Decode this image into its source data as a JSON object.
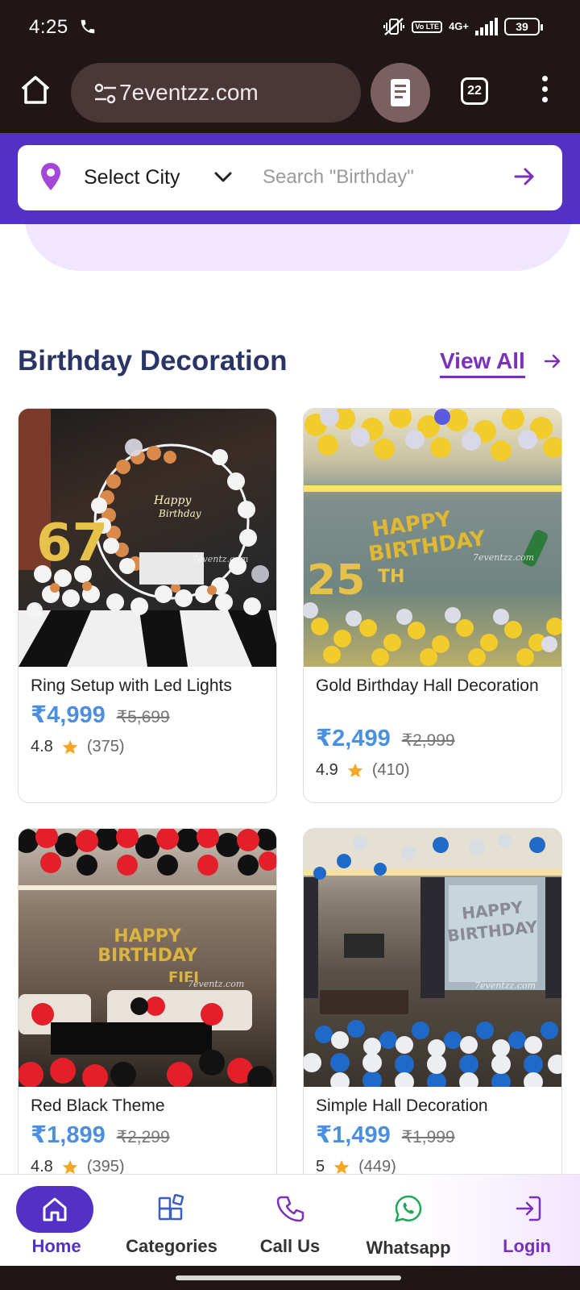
{
  "status_bar": {
    "time": "4:25",
    "volte_label": "Vo LTE",
    "network": "4G+",
    "battery": "39"
  },
  "browser": {
    "url": "7eventzz.com",
    "tab_count": "22"
  },
  "search": {
    "city_label": "Select City",
    "placeholder": "Search \"Birthday\""
  },
  "section": {
    "title": "Birthday Decoration",
    "view_all": "View All"
  },
  "products": [
    {
      "title": "Ring Setup with Led Lights",
      "price": "₹4,999",
      "mrp": "₹5,699",
      "rating": "4.8",
      "reviews": "(375)",
      "watermark": "7eventz.com"
    },
    {
      "title": "Gold Birthday Hall Decoration",
      "price": "₹2,499",
      "mrp": "₹2,999",
      "rating": "4.9",
      "reviews": "(410)",
      "watermark": "7eventzz.com"
    },
    {
      "title": "Red Black Theme",
      "price": "₹1,899",
      "mrp": "₹2,299",
      "rating": "4.8",
      "reviews": "(395)",
      "watermark": "7eventz.com"
    },
    {
      "title": "Simple Hall Decoration",
      "price": "₹1,499",
      "mrp": "₹1,999",
      "rating": "5",
      "reviews": "(449)",
      "watermark": "7eventzz.com"
    }
  ],
  "bottom_nav": {
    "items": [
      {
        "label": "Home",
        "icon": "home-icon"
      },
      {
        "label": "Categories",
        "icon": "categories-icon"
      },
      {
        "label": "Call Us",
        "icon": "phone-icon"
      },
      {
        "label": "Whatsapp",
        "icon": "whatsapp-icon"
      },
      {
        "label": "Login",
        "icon": "login-icon"
      }
    ]
  },
  "colors": {
    "brand_purple": "#5331c4",
    "accent_violet": "#7b2fbd",
    "price_blue": "#4a8fe0",
    "title_navy": "#2a3565",
    "star": "#f5a623"
  }
}
